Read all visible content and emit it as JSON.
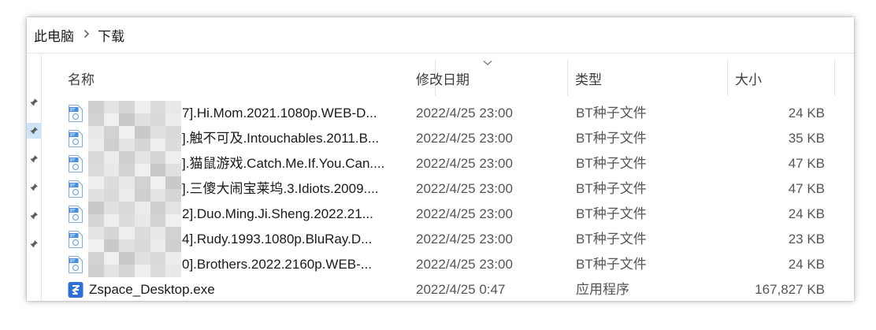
{
  "breadcrumb": {
    "root": "此电脑",
    "current": "下载"
  },
  "columns": {
    "name": "名称",
    "date": "修改日期",
    "type": "类型",
    "size": "大小"
  },
  "files": [
    {
      "name": "7].Hi.Mom.2021.1080p.WEB-D...",
      "date": "2022/4/25 23:00",
      "type": "BT种子文件",
      "size": "24 KB",
      "icon": "torrent-file-icon",
      "name_blurred": true
    },
    {
      "name": "].触不可及.Intouchables.2011.B...",
      "date": "2022/4/25 23:00",
      "type": "BT种子文件",
      "size": "35 KB",
      "icon": "torrent-file-icon",
      "name_blurred": true
    },
    {
      "name": "].猫鼠游戏.Catch.Me.If.You.Can....",
      "date": "2022/4/25 23:00",
      "type": "BT种子文件",
      "size": "47 KB",
      "icon": "torrent-file-icon",
      "name_blurred": true
    },
    {
      "name": "].三傻大闹宝莱坞.3.Idiots.2009....",
      "date": "2022/4/25 23:00",
      "type": "BT种子文件",
      "size": "47 KB",
      "icon": "torrent-file-icon",
      "name_blurred": true
    },
    {
      "name": "2].Duo.Ming.Ji.Sheng.2022.21...",
      "date": "2022/4/25 23:00",
      "type": "BT种子文件",
      "size": "24 KB",
      "icon": "torrent-file-icon",
      "name_blurred": true
    },
    {
      "name": "4].Rudy.1993.1080p.BluRay.D...",
      "date": "2022/4/25 23:00",
      "type": "BT种子文件",
      "size": "23 KB",
      "icon": "torrent-file-icon",
      "name_blurred": true
    },
    {
      "name": "0].Brothers.2022.2160p.WEB-...",
      "date": "2022/4/25 23:00",
      "type": "BT种子文件",
      "size": "24 KB",
      "icon": "torrent-file-icon",
      "name_blurred": true
    },
    {
      "name": "Zspace_Desktop.exe",
      "date": "2022/4/25 0:47",
      "type": "应用程序",
      "size": "167,827 KB",
      "icon": "zspace-app-icon",
      "name_blurred": false
    }
  ],
  "sidebar": {
    "pins": [
      "pin-icon",
      "pin-icon",
      "pin-icon",
      "pin-icon",
      "pin-icon",
      "pin-icon"
    ],
    "selected_pin": 1
  },
  "colors": {
    "selection": "#cfe4f7",
    "torrent_icon": "#4a8fd8",
    "app_icon": "#2f6fd6"
  }
}
